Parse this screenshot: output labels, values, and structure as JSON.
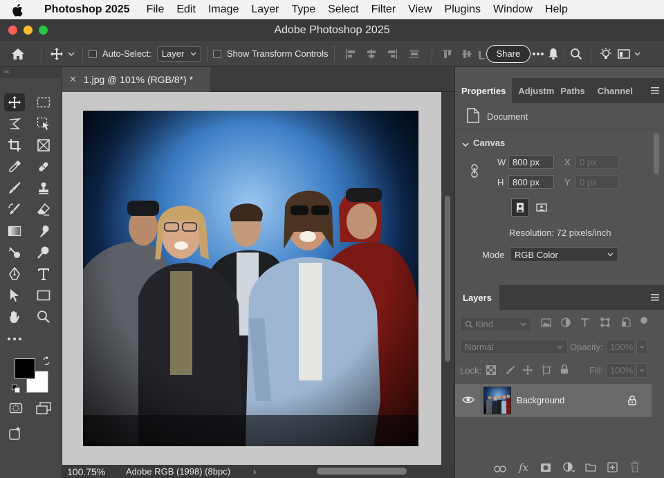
{
  "menubar": {
    "app_name": "Photoshop 2025",
    "items": [
      "File",
      "Edit",
      "Image",
      "Layer",
      "Type",
      "Select",
      "Filter",
      "View",
      "Plugins",
      "Window",
      "Help"
    ]
  },
  "window": {
    "title": "Adobe Photoshop 2025"
  },
  "options": {
    "auto_select_label": "Auto-Select:",
    "auto_select_value": "Layer",
    "show_transform_label": "Show Transform Controls",
    "share_label": "Share"
  },
  "document": {
    "tab_title": "1.jpg @ 101% (RGB/8*) *",
    "zoom": "100.75%",
    "color_profile": "Adobe RGB (1998) (8bpc)"
  },
  "properties": {
    "tabs": [
      "Properties",
      "Adjustm",
      "Paths",
      "Channel"
    ],
    "doc_label": "Document",
    "section_canvas": "Canvas",
    "w_label": "W",
    "w_value": "800 px",
    "h_label": "H",
    "h_value": "800 px",
    "x_label": "X",
    "x_placeholder": "0 px",
    "y_label": "Y",
    "y_placeholder": "0 px",
    "resolution": "Resolution: 72 pixels/inch",
    "mode_label": "Mode",
    "mode_value": "RGB Color"
  },
  "layers": {
    "tab": "Layers",
    "filter_kind": "Kind",
    "blend_mode": "Normal",
    "opacity_label": "Opacity:",
    "opacity_value": "100%",
    "lock_label": "Lock:",
    "fill_label": "Fill:",
    "fill_value": "100%",
    "items": [
      {
        "name": "Background",
        "visible": true,
        "locked": true
      }
    ]
  },
  "colors": {
    "accent_close": "#ff5f57",
    "accent_minimize": "#febc2e",
    "accent_zoom": "#28c840",
    "foreground_swatch": "#000000",
    "background_swatch": "#ffffff"
  }
}
